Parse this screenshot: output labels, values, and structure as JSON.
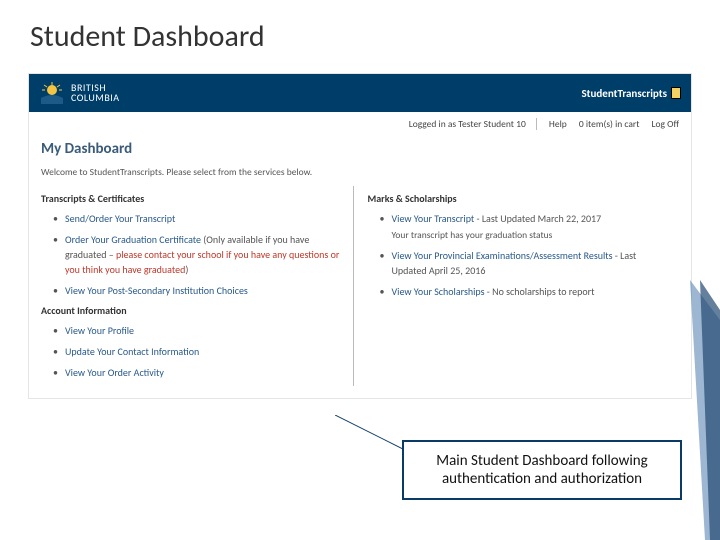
{
  "slide": {
    "title": "Student Dashboard"
  },
  "header": {
    "brand_top": "BRITISH",
    "brand_bottom": "COLUMBIA",
    "app_title": "StudentTranscripts"
  },
  "util": {
    "logged_in": "Logged in as Tester Student 10",
    "help": "Help",
    "cart": "0 item(s) in cart",
    "logoff": "Log Off"
  },
  "dashboard": {
    "title": "My Dashboard",
    "welcome": "Welcome to StudentTranscripts. Please select from the services below."
  },
  "left": {
    "section1": "Transcripts & Certificates",
    "items1": [
      {
        "link": "Send/Order Your Transcript"
      },
      {
        "link": "Order Your Graduation Certificate",
        "paren": " (Only available if you have graduated –",
        "warn": " please contact your school if you have any questions or you think you have graduated",
        "close": ")"
      },
      {
        "link": "View Your Post-Secondary Institution Choices"
      }
    ],
    "section2": "Account Information",
    "items2": [
      {
        "link": "View Your Profile"
      },
      {
        "link": "Update Your Contact Information"
      },
      {
        "link": "View Your Order Activity"
      }
    ]
  },
  "right": {
    "section1": "Marks & Scholarships",
    "items1": [
      {
        "link": "View Your Transcript",
        "suffix": " - Last Updated March 22, 2017",
        "sub": "Your transcript has your graduation status"
      },
      {
        "link": "View Your Provincial Examinations/Assessment Results",
        "suffix": " - Last Updated April 25, 2016"
      },
      {
        "link": "View Your Scholarships",
        "suffix": " - No scholarships to report"
      }
    ]
  },
  "callout": {
    "text": "Main Student Dashboard following authentication and authorization"
  }
}
